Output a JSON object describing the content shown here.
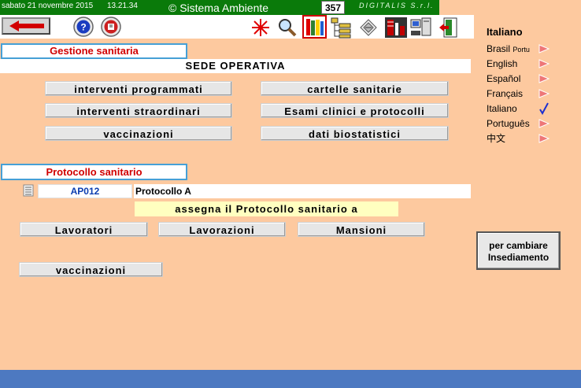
{
  "topbar": {
    "date": "sabato 21 novembre 2015",
    "time": "13.21.34",
    "copyright": "© Sistema Ambiente",
    "badge": "357",
    "company": "DIGITALIS S.r.l."
  },
  "colors": {
    "topbar": "#0a7a0a",
    "background": "#fdc99f",
    "panel_border": "#46a0d6",
    "header_text": "#d10000",
    "code_text": "#0b3db0",
    "highlight": "#ffffc0",
    "bottombar": "#4d79c1"
  },
  "toolbar": {
    "icons": [
      "back-arrow-icon",
      "help-icon",
      "info-icon",
      "snowflake-icon",
      "search-icon",
      "folders-icon",
      "tree-list-icon",
      "documents-icon",
      "chart-icon",
      "computer-icon",
      "exit-icon"
    ]
  },
  "sidebar": {
    "title": "Italiano",
    "languages": [
      {
        "label": "Brasil",
        "sublabel": "Portu",
        "selected": false
      },
      {
        "label": "English",
        "selected": false
      },
      {
        "label": "Español",
        "selected": false
      },
      {
        "label": "Français",
        "selected": false
      },
      {
        "label": "Italiano",
        "selected": true
      },
      {
        "label": "Português",
        "selected": false
      },
      {
        "label": "中文",
        "selected": false
      }
    ]
  },
  "gestione": {
    "header": "Gestione sanitaria",
    "location": "SEDE OPERATIVA",
    "buttons": [
      "interventi programmati",
      "cartelle sanitarie",
      "interventi straordinari",
      "Esami clinici e protocolli",
      "vaccinazioni",
      "dati biostatistici"
    ]
  },
  "protocollo": {
    "header": "Protocollo sanitario",
    "code": "AP012",
    "name": "Protocollo A",
    "assign_label": "assegna il Protocollo sanitario a",
    "buttons": [
      "Lavoratori",
      "Lavorazioni",
      "Mansioni"
    ],
    "vaccinazioni": "vaccinazioni"
  },
  "cambia_button": "per cambiare Insediamento"
}
